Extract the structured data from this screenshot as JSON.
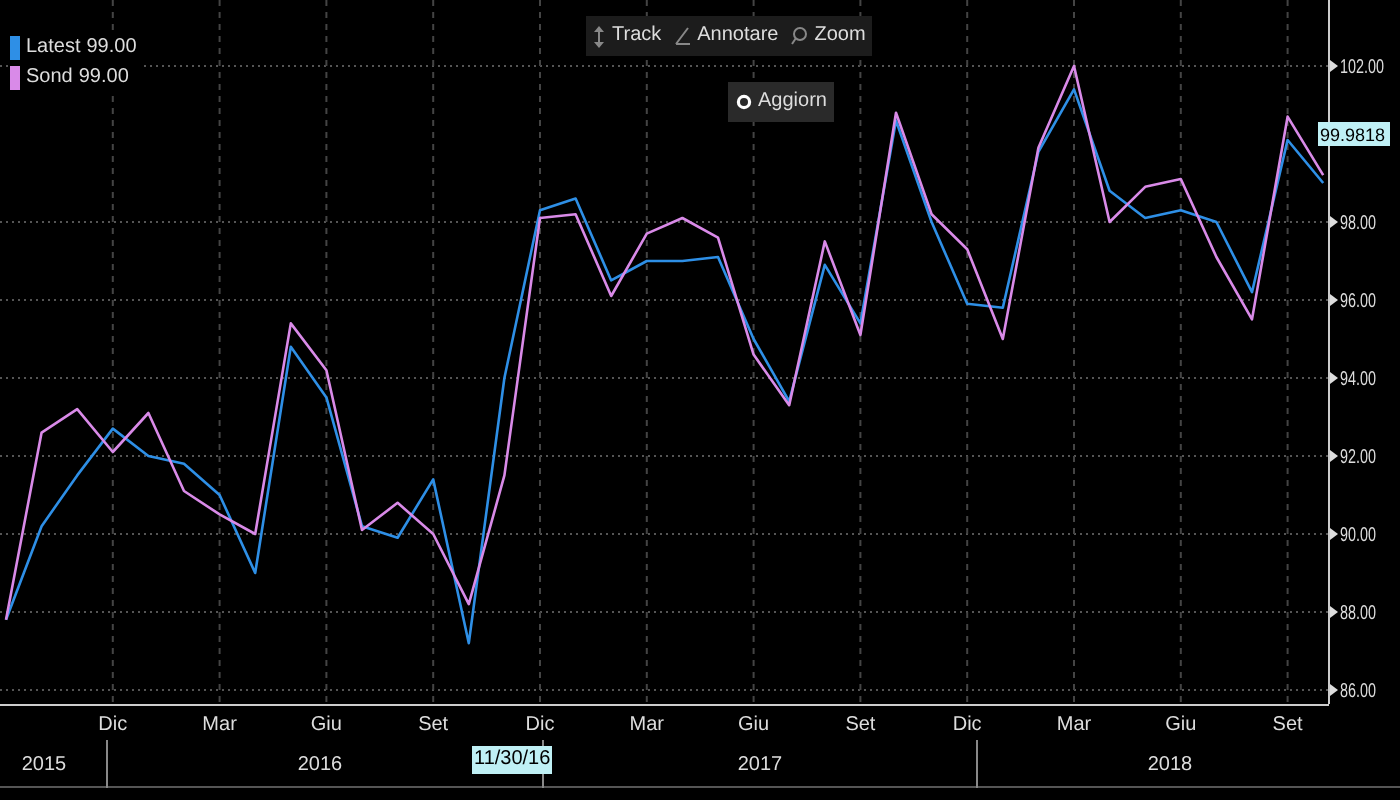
{
  "toolbar": [
    {
      "kind": "track",
      "label": "Track"
    },
    {
      "kind": "annotate",
      "label": "Annotare"
    },
    {
      "kind": "zoom",
      "label": "Zoom"
    }
  ],
  "refresh_button": {
    "label": "Aggiorn"
  },
  "legend_values": [
    "99.00",
    "99.00"
  ],
  "last_value_tag": "99.9818",
  "cursor_date": "11/30/16",
  "year_labels": [
    "2015",
    "2016",
    "2017",
    "2018"
  ],
  "chart": {
    "chart_data": {
      "type": "line",
      "categories": [
        null,
        null,
        null,
        "Dic",
        null,
        null,
        "Mar",
        null,
        null,
        "Giu",
        null,
        null,
        "Set",
        null,
        null,
        "Dic",
        null,
        null,
        "Mar",
        null,
        null,
        "Giu",
        null,
        null,
        "Set",
        null,
        null,
        "Dic",
        null,
        null,
        "Mar",
        null,
        null,
        "Giu",
        null,
        null,
        "Set",
        null
      ],
      "series": [
        {
          "name": "Latest",
          "color": "#2e8fe6",
          "values": [
            87.8,
            90.2,
            91.5,
            92.7,
            92,
            91.8,
            91,
            89,
            94.8,
            93.5,
            90.2,
            89.9,
            91.4,
            87.2,
            94,
            98.3,
            98.6,
            96.5,
            97,
            97,
            97.1,
            95,
            93.4,
            96.9,
            95.4,
            100.6,
            98,
            95.9,
            95.8,
            99.8,
            101.4,
            98.8,
            98.1,
            98.3,
            98,
            96.2,
            100.1,
            99
          ]
        },
        {
          "name": "Sond",
          "color": "#d98ae8",
          "values": [
            87.8,
            92.6,
            93.2,
            92.1,
            93.1,
            91.1,
            90.5,
            90,
            95.4,
            94.2,
            90.1,
            90.8,
            90,
            88.2,
            91.5,
            98.1,
            98.2,
            96.1,
            97.7,
            98.1,
            97.6,
            94.6,
            93.3,
            97.5,
            95.1,
            100.8,
            98.2,
            97.3,
            95,
            99.9,
            102,
            98,
            98.9,
            99.1,
            97.1,
            95.5,
            100.7,
            99.2
          ]
        }
      ],
      "yticks": [
        {
          "value": 86,
          "label": "86.00"
        },
        {
          "value": 88,
          "label": "88.00"
        },
        {
          "value": 90,
          "label": "90.00"
        },
        {
          "value": 92,
          "label": "92.00"
        },
        {
          "value": 94,
          "label": "94.00"
        },
        {
          "value": 96,
          "label": "96.00"
        },
        {
          "value": 98,
          "label": "98.00"
        },
        {
          "value": 102,
          "label": "102.00"
        }
      ],
      "ylim": [
        85.64,
        103.69
      ],
      "grid": true
    }
  }
}
